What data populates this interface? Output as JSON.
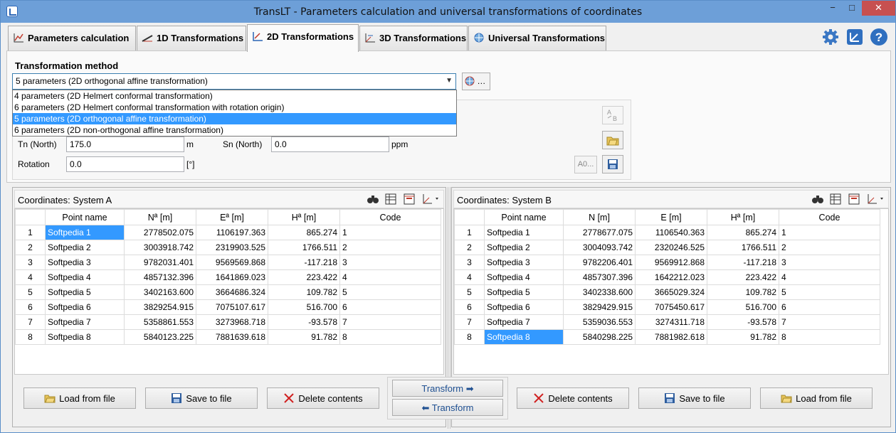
{
  "window": {
    "title": "TransLT - Parameters calculation and universal transformations of coordinates",
    "controls": {
      "minimize": "−",
      "maximize": "□",
      "close": "✕"
    }
  },
  "tabs": [
    {
      "label": "Parameters calculation",
      "icon": "chart-icon"
    },
    {
      "label": "1D Transformations",
      "icon": "ruler-icon"
    },
    {
      "label": "2D Transformations",
      "icon": "axes-2d-icon",
      "active": true
    },
    {
      "label": "3D Transformations",
      "icon": "axes-3d-icon"
    },
    {
      "label": "Universal Transformations",
      "icon": "globe-icon"
    }
  ],
  "method": {
    "heading": "Transformation method",
    "selected": "5 parameters (2D orthogonal affine transformation)",
    "globe_button": "…",
    "options": [
      "4 parameters (2D Helmert conformal transformation)",
      "6 parameters (2D Helmert conformal transformation with rotation origin)",
      "5 parameters (2D orthogonal affine transformation)",
      "6 parameters (2D non-orthogonal affine transformation)"
    ],
    "selected_index": 2
  },
  "params": {
    "tn_label": "Tn (North)",
    "tn_value": "175.0",
    "tn_unit": "m",
    "sn_label": "Sn (North)",
    "sn_value": "0.0",
    "sn_unit": "ppm",
    "rot_label": "Rotation",
    "rot_value": "0.0",
    "rot_unit": "[°]",
    "a0_button": "A0..."
  },
  "system_a": {
    "title": "Coordinates: System A",
    "columns": [
      "",
      "Point name",
      "Nª [m]",
      "Eª [m]",
      "Hª [m]",
      "Code"
    ],
    "rows": [
      [
        "1",
        "Softpedia 1",
        "2778502.075",
        "1106197.363",
        "865.274",
        "1"
      ],
      [
        "2",
        "Softpedia 2",
        "3003918.742",
        "2319903.525",
        "1766.511",
        "2"
      ],
      [
        "3",
        "Softpedia 3",
        "9782031.401",
        "9569569.868",
        "-117.218",
        "3"
      ],
      [
        "4",
        "Softpedia 4",
        "4857132.396",
        "1641869.023",
        "223.422",
        "4"
      ],
      [
        "5",
        "Softpedia 5",
        "3402163.600",
        "3664686.324",
        "109.782",
        "5"
      ],
      [
        "6",
        "Softpedia 6",
        "3829254.915",
        "7075107.617",
        "516.700",
        "6"
      ],
      [
        "7",
        "Softpedia 7",
        "5358861.553",
        "3273968.718",
        "-93.578",
        "7"
      ],
      [
        "8",
        "Softpedia 8",
        "5840123.225",
        "7881639.618",
        "91.782",
        "8"
      ]
    ],
    "selected_row": 0,
    "buttons": {
      "load": "Load from file",
      "save": "Save to file",
      "delete": "Delete contents"
    }
  },
  "system_b": {
    "title": "Coordinates: System B",
    "columns": [
      "",
      "Point name",
      "N [m]",
      "E [m]",
      "Hª [m]",
      "Code"
    ],
    "rows": [
      [
        "1",
        "Softpedia 1",
        "2778677.075",
        "1106540.363",
        "865.274",
        "1"
      ],
      [
        "2",
        "Softpedia 2",
        "3004093.742",
        "2320246.525",
        "1766.511",
        "2"
      ],
      [
        "3",
        "Softpedia 3",
        "9782206.401",
        "9569912.868",
        "-117.218",
        "3"
      ],
      [
        "4",
        "Softpedia 4",
        "4857307.396",
        "1642212.023",
        "223.422",
        "4"
      ],
      [
        "5",
        "Softpedia 5",
        "3402338.600",
        "3665029.324",
        "109.782",
        "5"
      ],
      [
        "6",
        "Softpedia 6",
        "3829429.915",
        "7075450.617",
        "516.700",
        "6"
      ],
      [
        "7",
        "Softpedia 7",
        "5359036.553",
        "3274311.718",
        "-93.578",
        "7"
      ],
      [
        "8",
        "Softpedia 8",
        "5840298.225",
        "7881982.618",
        "91.782",
        "8"
      ]
    ],
    "selected_row": 7,
    "buttons": {
      "load": "Load from file",
      "save": "Save to file",
      "delete": "Delete contents"
    }
  },
  "transform": {
    "forward": "Transform ➡",
    "backward": "⬅ Transform"
  },
  "colors": {
    "accent": "#3399ff",
    "titlebar": "#6d9fd8",
    "close": "#c75050"
  }
}
